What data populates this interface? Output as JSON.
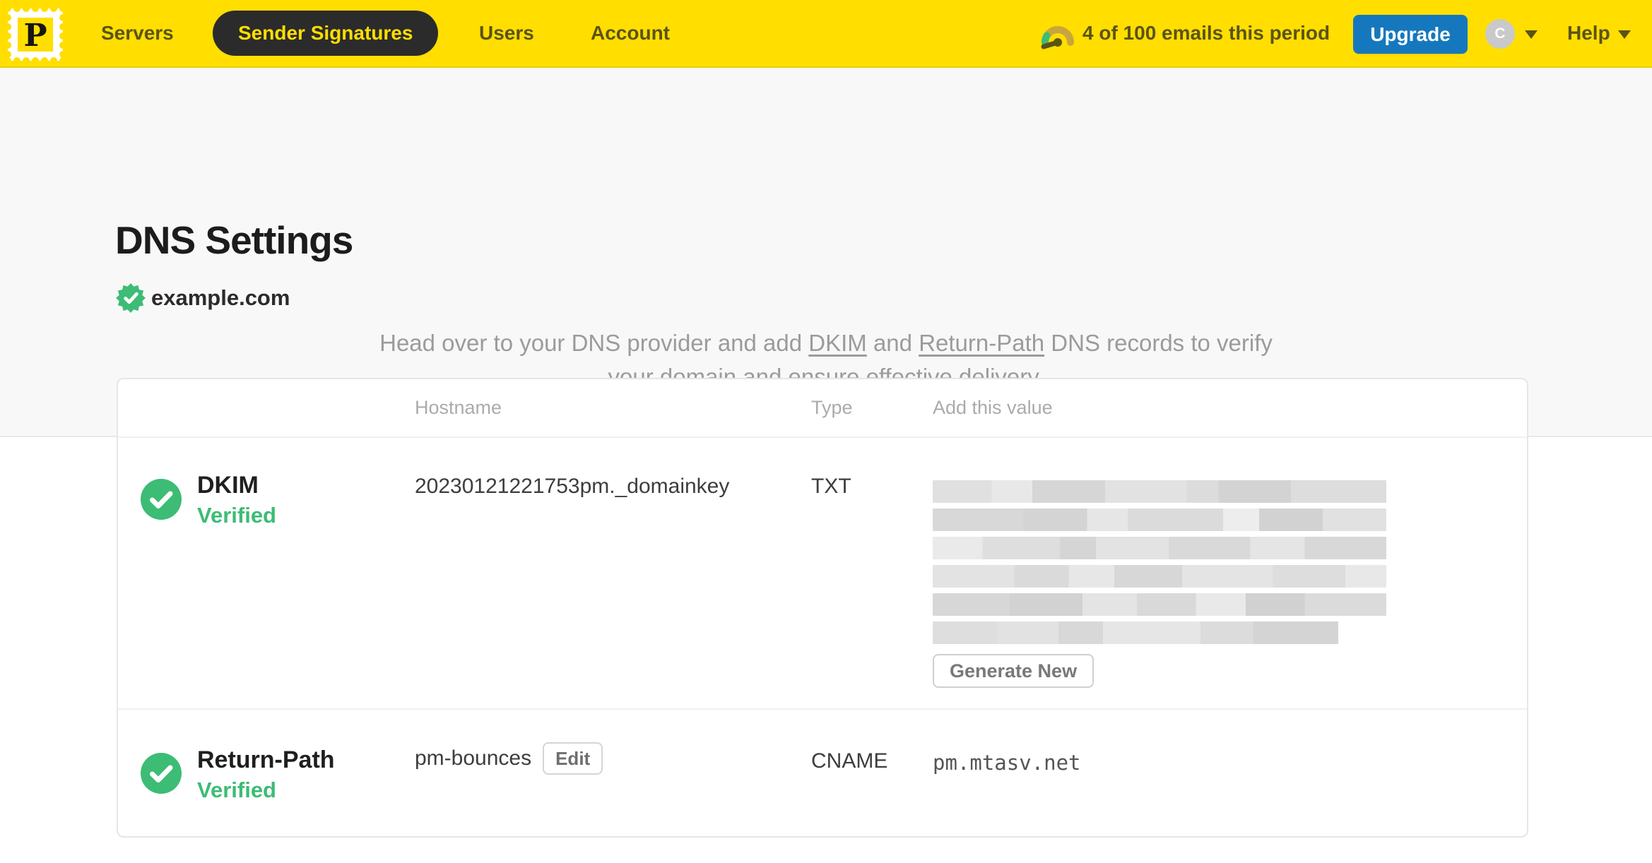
{
  "nav": {
    "logo_letter": "P",
    "items": [
      {
        "label": "Servers",
        "active": false
      },
      {
        "label": "Sender Signatures",
        "active": true
      },
      {
        "label": "Users",
        "active": false
      },
      {
        "label": "Account",
        "active": false
      }
    ],
    "usage_text": "4 of 100 emails this period",
    "upgrade_label": "Upgrade",
    "avatar_initial": "C",
    "help_label": "Help"
  },
  "page": {
    "title": "DNS Settings",
    "domain": "example.com",
    "domain_verified": true,
    "lead": {
      "before": "Head over to your DNS provider and add ",
      "link_dkim": "DKIM",
      "middle": " and ",
      "link_return_path": "Return-Path",
      "after": " DNS records to verify your domain and ensure effective delivery."
    }
  },
  "table": {
    "headers": {
      "hostname": "Hostname",
      "type": "Type",
      "value": "Add this value"
    },
    "rows": [
      {
        "name": "DKIM",
        "status": "Verified",
        "hostname": "20230121221753pm._domainkey",
        "type": "TXT",
        "value": "(redacted DKIM key)",
        "value_redacted": true,
        "action_label": "Generate New"
      },
      {
        "name": "Return-Path",
        "status": "Verified",
        "hostname": "pm-bounces",
        "hostname_action": "Edit",
        "type": "CNAME",
        "value": "pm.mtasv.net",
        "value_redacted": false
      }
    ]
  },
  "colors": {
    "brand_yellow": "#FFDE00",
    "nav_ink": "#5B5316",
    "active_pill_bg": "#2B2B2B",
    "upgrade_blue": "#1578BE",
    "verified_green": "#3DBC75",
    "heading_ink": "#1C1C1C",
    "lead_gray": "#9B9B9B"
  }
}
